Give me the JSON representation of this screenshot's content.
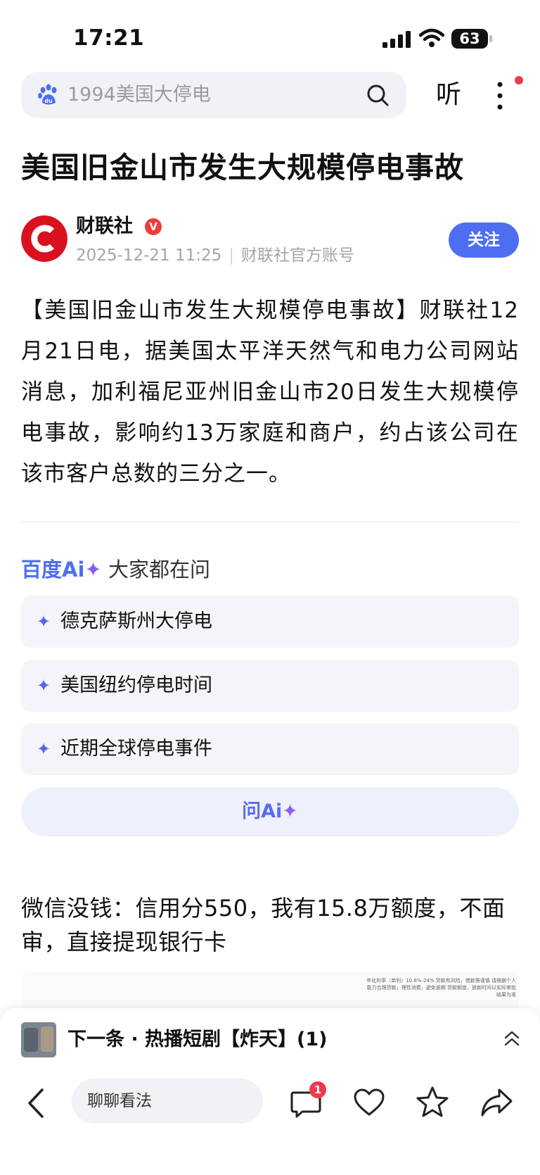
{
  "status_bar": {
    "time": "17:21",
    "battery": "63"
  },
  "search": {
    "query": "1994美国大停电",
    "listen_label": "听"
  },
  "article": {
    "title": "美国旧金山市发生大规模停电事故",
    "author": "财联社",
    "verified_mark": "V",
    "date": "2025-12-21 11:25",
    "source": "财联社官方账号",
    "follow_label": "关注",
    "body": "【美国旧金山市发生大规模停电事故】财联社12月21日电，据美国太平洋天然气和电力公司网站消息，加利福尼亚州旧金山市20日发生大规模停电事故，影响约13万家庭和商户，约占该公司在该市客户总数的三分之一。"
  },
  "ai_section": {
    "logo_text": "百度",
    "logo_ai": "Ai",
    "heading": "大家都在问",
    "questions": [
      {
        "label": "德克萨斯州大停电"
      },
      {
        "label": "美国纽约停电时间"
      },
      {
        "label": "近期全球停电事件"
      }
    ],
    "ask_button": "问Ai"
  },
  "ad": {
    "title": "微信没钱：信用分550，我有15.8万额度，不面审，直接提现银行卡",
    "fine_print": "年化利率（单利）10.8%-24% 贷款有风险，借款需谨慎 请根据个人能力合理贷款，理性消费，避免逾期 贷款额度、放款时间以实际审批结果为准"
  },
  "next_up": {
    "label": "下一条 · 热播短剧【炸天】(1)"
  },
  "toolbar": {
    "comment_placeholder": "聊聊看法",
    "comment_badge": "1"
  },
  "colors": {
    "accent": "#4e6ef2",
    "red": "#f0384b",
    "logo_red": "#d9111f"
  }
}
